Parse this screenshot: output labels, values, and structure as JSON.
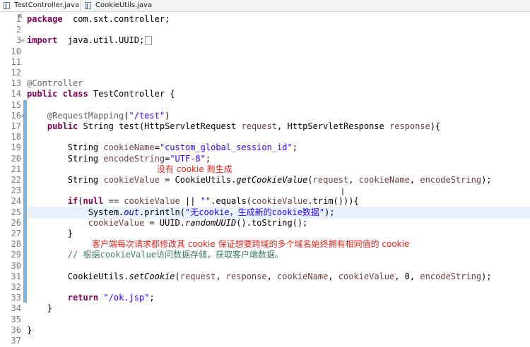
{
  "tabs": [
    {
      "label": "TestController.java",
      "close": "✕"
    },
    {
      "label": "CookieUtils.java",
      "close": ""
    }
  ],
  "lines": [
    {
      "n": "1",
      "code": [
        [
          "kw",
          "package"
        ],
        [
          "",
          "  com.sxt.controller;"
        ]
      ]
    },
    {
      "n": "2",
      "code": []
    },
    {
      "n": "3",
      "fold": "⊕",
      "code": [
        [
          "kw",
          "import"
        ],
        [
          "",
          "  java.util.UUID;"
        ]
      ],
      "box": true
    },
    {
      "n": "10",
      "code": []
    },
    {
      "n": "11",
      "code": []
    },
    {
      "n": "12",
      "code": []
    },
    {
      "n": "13",
      "code": [
        [
          "ann",
          "@Controller"
        ]
      ]
    },
    {
      "n": "14",
      "code": [
        [
          "kw",
          "public class"
        ],
        [
          "",
          " TestController {"
        ]
      ]
    },
    {
      "n": "15",
      "code": []
    },
    {
      "n": "16",
      "fold": "⊖",
      "code": [
        [
          "",
          "    "
        ],
        [
          "ann",
          "@RequestMapping"
        ],
        [
          "",
          "("
        ],
        [
          "str",
          "\"/test\""
        ],
        [
          "",
          ")"
        ]
      ]
    },
    {
      "n": "17",
      "code": [
        [
          "",
          "    "
        ],
        [
          "kw",
          "public"
        ],
        [
          "",
          " String test(HttpServletRequest "
        ],
        [
          "var",
          "request"
        ],
        [
          "",
          ", HttpServletResponse "
        ],
        [
          "var",
          "response"
        ],
        [
          "",
          "){"
        ]
      ]
    },
    {
      "n": "18",
      "code": []
    },
    {
      "n": "19",
      "code": [
        [
          "",
          "        String "
        ],
        [
          "var",
          "cookieName"
        ],
        [
          "",
          "="
        ],
        [
          "str",
          "\"custom_global_session_id\""
        ],
        [
          "",
          ";"
        ]
      ]
    },
    {
      "n": "20",
      "code": [
        [
          "",
          "        String "
        ],
        [
          "var",
          "encodeString"
        ],
        [
          "",
          "="
        ],
        [
          "str",
          "\"UTF-8\""
        ],
        [
          "",
          ";"
        ]
      ]
    },
    {
      "n": "21",
      "code": []
    },
    {
      "n": "22",
      "code": [
        [
          "",
          "        String "
        ],
        [
          "var",
          "cookieValue"
        ],
        [
          "",
          " = CookieUtils."
        ],
        [
          "it",
          "getCookieValue"
        ],
        [
          "",
          "("
        ],
        [
          "var",
          "request"
        ],
        [
          "",
          ", "
        ],
        [
          "var",
          "cookieName"
        ],
        [
          "",
          ", "
        ],
        [
          "var",
          "encodeString"
        ],
        [
          "",
          ");"
        ]
      ]
    },
    {
      "n": "23",
      "code": []
    },
    {
      "n": "24",
      "code": [
        [
          "",
          "        "
        ],
        [
          "kw",
          "if"
        ],
        [
          "",
          "("
        ],
        [
          "kw",
          "null"
        ],
        [
          "",
          " == "
        ],
        [
          "var",
          "cookieValue"
        ],
        [
          "",
          " || "
        ],
        [
          "str",
          "\"\""
        ],
        [
          "",
          ".equals("
        ],
        [
          "var",
          "cookieValue"
        ],
        [
          "",
          ".trim())){"
        ]
      ]
    },
    {
      "n": "25",
      "highlight": true,
      "code": [
        [
          "",
          "            System."
        ],
        [
          "field",
          "out"
        ],
        [
          "",
          ".println("
        ],
        [
          "str",
          "\"无cookie，生成新的cookie数据\""
        ],
        [
          "",
          ");"
        ]
      ]
    },
    {
      "n": "26",
      "code": [
        [
          "",
          "            "
        ],
        [
          "var",
          "cookieValue"
        ],
        [
          "",
          " = UUID."
        ],
        [
          "it",
          "randomUUID"
        ],
        [
          "",
          "().toString();"
        ]
      ]
    },
    {
      "n": "27",
      "code": [
        [
          "",
          "        }"
        ]
      ]
    },
    {
      "n": "28",
      "code": []
    },
    {
      "n": "29",
      "code": [
        [
          "",
          "        "
        ],
        [
          "cmt",
          "// 根据cookieValue访问数据存储，获取客户端数据。"
        ]
      ]
    },
    {
      "n": "30",
      "code": []
    },
    {
      "n": "31",
      "code": [
        [
          "",
          "        CookieUtils."
        ],
        [
          "it",
          "setCookie"
        ],
        [
          "",
          "("
        ],
        [
          "var",
          "request"
        ],
        [
          "",
          ", "
        ],
        [
          "var",
          "response"
        ],
        [
          "",
          ", "
        ],
        [
          "var",
          "cookieName"
        ],
        [
          "",
          ", "
        ],
        [
          "var",
          "cookieValue"
        ],
        [
          "",
          ", 0, "
        ],
        [
          "var",
          "encodeString"
        ],
        [
          "",
          ");"
        ]
      ]
    },
    {
      "n": "32",
      "code": []
    },
    {
      "n": "33",
      "code": [
        [
          "",
          "        "
        ],
        [
          "kw",
          "return"
        ],
        [
          "",
          " "
        ],
        [
          "str",
          "\"/ok.jsp\""
        ],
        [
          "",
          ";"
        ]
      ]
    },
    {
      "n": "34",
      "code": [
        [
          "",
          "    }"
        ]
      ]
    },
    {
      "n": "35",
      "code": []
    },
    {
      "n": "36",
      "code": [
        [
          "",
          "}"
        ]
      ]
    },
    {
      "n": "37",
      "code": []
    }
  ],
  "annotations": {
    "note1": "没有 cookie 则生成",
    "note2": "客户端每次请求都修改其 cookie 保证想要跨域的多个域名始终拥有相同值的 cookie"
  },
  "cursor_glyph": "I",
  "colors": {
    "keyword": "#7f0055",
    "string": "#2a00ff",
    "annotation": "#646464",
    "field": "#0000c0",
    "comment": "#3f7f5f",
    "note": "#e2231a",
    "current_line": "#e8f2fe",
    "gutter_marker": "#7ab3e0"
  }
}
